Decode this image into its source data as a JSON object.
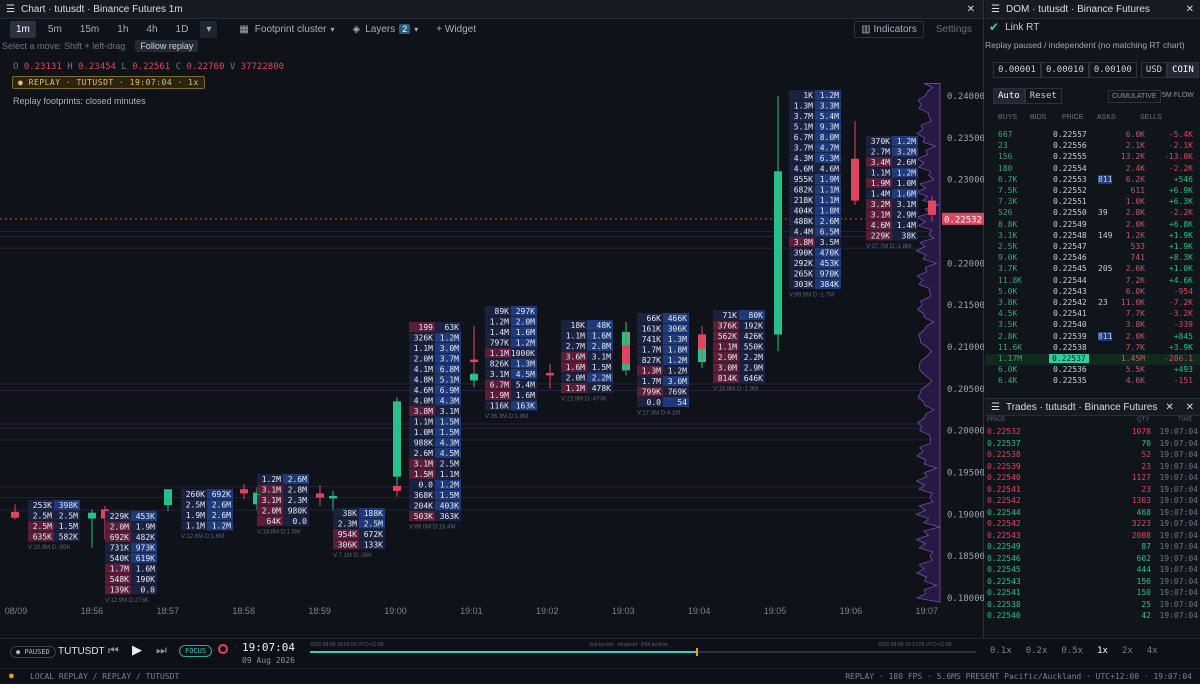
{
  "chart_panel": {
    "title": "Chart · tutusdt · Binance Futures 1m",
    "timeframes": [
      "1m",
      "5m",
      "15m",
      "1h",
      "4h",
      "1D"
    ],
    "active_timeframe": "1m",
    "footprint_label": "Footprint cluster",
    "layers_label": "Layers",
    "layers_count": "2",
    "widget_label": "+ Widget",
    "indicators_label": "Indicators",
    "settings_label": "Settings",
    "hint": "Select a move: Shift + left-drag",
    "follow_label": "Follow replay",
    "ohlc": {
      "o_label": "O",
      "o": "0.23131",
      "h_label": "H",
      "h": "0.23454",
      "l_label": "L",
      "l": "0.22561",
      "c_label": "C",
      "c": "0.22760",
      "v_label": "V",
      "v": "37722800"
    },
    "replay_badge": "● REPLAY · TUTUSDT · 19:07:04 · 1x",
    "footprint_note": "Replay footprints: closed minutes",
    "price_tag": "0.22532"
  },
  "chart_data": {
    "type": "candlestick",
    "y_ticks": [
      "0.24000",
      "0.23500",
      "0.23000",
      "0.22500",
      "0.22000",
      "0.21500",
      "0.21000",
      "0.20500",
      "0.20000",
      "0.19500",
      "0.19000",
      "0.18500",
      "0.18000"
    ],
    "y_range": [
      0.1795,
      0.2418
    ],
    "x_ticks": [
      "08/09",
      "18:56",
      "18:57",
      "18:58",
      "18:59",
      "19:00",
      "19:01",
      "19:02",
      "19:03",
      "19:04",
      "19:05",
      "19:06",
      "19:07"
    ],
    "candles": [
      {
        "o": 0.1903,
        "h": 0.1912,
        "l": 0.1894,
        "c": 0.1896,
        "bull": false
      },
      {
        "o": 0.1895,
        "h": 0.1906,
        "l": 0.186,
        "c": 0.1902,
        "bull": true
      },
      {
        "o": 0.1906,
        "h": 0.191,
        "l": 0.187,
        "c": 0.1895,
        "bull": false
      },
      {
        "o": 0.1911,
        "h": 0.1918,
        "l": 0.1904,
        "c": 0.193,
        "bull": true
      },
      {
        "o": 0.193,
        "h": 0.1936,
        "l": 0.1918,
        "c": 0.1925,
        "bull": false
      },
      {
        "o": 0.1912,
        "h": 0.1932,
        "l": 0.1905,
        "c": 0.1926,
        "bull": true
      },
      {
        "o": 0.1925,
        "h": 0.1935,
        "l": 0.191,
        "c": 0.192,
        "bull": false
      },
      {
        "o": 0.1919,
        "h": 0.1928,
        "l": 0.1904,
        "c": 0.1922,
        "bull": true
      },
      {
        "o": 0.1928,
        "h": 0.1942,
        "l": 0.1921,
        "c": 0.1934,
        "bull": false
      },
      {
        "o": 0.1945,
        "h": 0.204,
        "l": 0.1936,
        "c": 0.2035,
        "bull": true
      },
      {
        "o": 0.206,
        "h": 0.2072,
        "l": 0.2052,
        "c": 0.2068,
        "bull": true
      },
      {
        "o": 0.2085,
        "h": 0.2125,
        "l": 0.207,
        "c": 0.2082,
        "bull": false
      },
      {
        "o": 0.2069,
        "h": 0.208,
        "l": 0.205,
        "c": 0.2066,
        "bull": false
      },
      {
        "o": 0.2072,
        "h": 0.213,
        "l": 0.2066,
        "c": 0.2118,
        "bull": true
      },
      {
        "o": 0.2102,
        "h": 0.2118,
        "l": 0.207,
        "c": 0.208,
        "bull": false
      },
      {
        "o": 0.2082,
        "h": 0.2125,
        "l": 0.2075,
        "c": 0.211,
        "bull": true
      },
      {
        "o": 0.2115,
        "h": 0.2125,
        "l": 0.2085,
        "c": 0.2098,
        "bull": false
      },
      {
        "o": 0.2115,
        "h": 0.24,
        "l": 0.2095,
        "c": 0.231,
        "bull": true
      },
      {
        "o": 0.2325,
        "h": 0.237,
        "l": 0.227,
        "c": 0.2305,
        "bull": false
      },
      {
        "o": 0.2312,
        "h": 0.234,
        "l": 0.227,
        "c": 0.2275,
        "bull": false
      },
      {
        "o": 0.2275,
        "h": 0.228,
        "l": 0.225,
        "c": 0.2258,
        "bull": false
      }
    ],
    "footprints": [
      {
        "x": 28,
        "y": 500,
        "rows": [
          [
            "253K",
            "398K"
          ],
          [
            "2.5M",
            "2.5M"
          ],
          [
            "2.5M",
            "1.5M"
          ],
          [
            "635K",
            "582K"
          ]
        ],
        "foot": "V:10.9M D:-99K"
      },
      {
        "x": 105,
        "y": 511,
        "rows": [
          [
            "229K",
            "453K"
          ],
          [
            "2.0M",
            "1.9M"
          ],
          [
            "692K",
            "482K"
          ],
          [
            "731K",
            "973K"
          ],
          [
            "540K",
            "619K"
          ],
          [
            "1.7M",
            "1.6M"
          ],
          [
            "548K",
            "190K"
          ],
          [
            "139K",
            "0.0"
          ]
        ],
        "foot": "V:12.9M D:273K"
      },
      {
        "x": 181,
        "y": 489,
        "rows": [
          [
            "260K",
            "692K"
          ],
          [
            "2.5M",
            "2.6M"
          ],
          [
            "1.9M",
            "2.6M"
          ],
          [
            "1.1M",
            "1.2M"
          ]
        ],
        "foot": "V:12.6M D:1.6M"
      },
      {
        "x": 257,
        "y": 474,
        "rows": [
          [
            "1.2M",
            "2.6M"
          ],
          [
            "3.1M",
            "2.8M"
          ],
          [
            "3.1M",
            "2.3M"
          ],
          [
            "2.0M",
            "980K"
          ],
          [
            "64K",
            "0.0"
          ]
        ],
        "foot": "V:18.8M D:1.5M"
      },
      {
        "x": 333,
        "y": 508,
        "rows": [
          [
            "38K",
            "188K"
          ],
          [
            "2.3M",
            "2.5M"
          ],
          [
            "954K",
            "672K"
          ],
          [
            "306K",
            "133K"
          ]
        ],
        "foot": "V:7.1M D:-26K"
      },
      {
        "x": 409,
        "y": 322,
        "rows": [
          [
            "199",
            "63K"
          ],
          [
            "326K",
            "1.2M"
          ],
          [
            "1.1M",
            "3.0M"
          ],
          [
            "2.0M",
            "3.7M"
          ],
          [
            "4.1M",
            "6.8M"
          ],
          [
            "4.8M",
            "5.1M"
          ],
          [
            "4.6M",
            "6.9M"
          ],
          [
            "4.0M",
            "4.3M"
          ],
          [
            "3.8M",
            "3.1M"
          ],
          [
            "1.1M",
            "1.5M"
          ],
          [
            "1.0M",
            "1.5M"
          ],
          [
            "988K",
            "4.3M"
          ],
          [
            "2.6M",
            "4.5M"
          ],
          [
            "3.1M",
            "2.5M"
          ],
          [
            "1.5M",
            "1.1M"
          ],
          [
            "0.0",
            "1.2M"
          ],
          [
            "368K",
            "1.5M"
          ],
          [
            "204K",
            "403K"
          ],
          [
            "503K",
            "363K"
          ]
        ],
        "foot": "V:89.0M D:18.4M"
      },
      {
        "x": 485,
        "y": 306,
        "rows": [
          [
            "89K",
            "297K"
          ],
          [
            "1.2M",
            "2.0M"
          ],
          [
            "1.4M",
            "1.6M"
          ],
          [
            "797K",
            "1.2M"
          ],
          [
            "1.1M",
            "1000K"
          ],
          [
            "826K",
            "1.3M"
          ],
          [
            "3.1M",
            "4.5M"
          ],
          [
            "6.7M",
            "5.4M"
          ],
          [
            "1.9M",
            "1.6M"
          ],
          [
            "116K",
            "163K"
          ]
        ],
        "foot": "V:36.3M D:1.8M"
      },
      {
        "x": 561,
        "y": 320,
        "rows": [
          [
            "18K",
            "48K"
          ],
          [
            "1.1M",
            "1.6M"
          ],
          [
            "2.7M",
            "2.8M"
          ],
          [
            "3.6M",
            "3.1M"
          ],
          [
            "1.6M",
            "1.5M"
          ],
          [
            "2.0M",
            "2.2M"
          ],
          [
            "1.1M",
            "478K"
          ]
        ],
        "foot": "V:23.9M D:-470K"
      },
      {
        "x": 637,
        "y": 313,
        "rows": [
          [
            "66K",
            "466K"
          ],
          [
            "161K",
            "306K"
          ],
          [
            "741K",
            "1.3M"
          ],
          [
            "1.7M",
            "1.8M"
          ],
          [
            "827K",
            "1.2M"
          ],
          [
            "1.3M",
            "1.2M"
          ],
          [
            "1.7M",
            "3.0M"
          ],
          [
            "799K",
            "769K"
          ],
          [
            "0.0",
            "54"
          ]
        ],
        "foot": "V:17.3M D:4.1M"
      },
      {
        "x": 713,
        "y": 310,
        "rows": [
          [
            "71K",
            "80K"
          ],
          [
            "376K",
            "192K"
          ],
          [
            "562K",
            "426K"
          ],
          [
            "1.1M",
            "550K"
          ],
          [
            "2.9M",
            "2.2M"
          ],
          [
            "3.0M",
            "2.9M"
          ],
          [
            "814K",
            "646K"
          ]
        ],
        "foot": "V:15.8M D:-1.9M"
      },
      {
        "x": 789,
        "y": 90,
        "rows": [
          [
            "1K",
            "1.2M"
          ],
          [
            "1.3M",
            "3.3M"
          ],
          [
            "3.7M",
            "5.4M"
          ],
          [
            "5.1M",
            "9.3M"
          ],
          [
            "6.7M",
            "8.0M"
          ],
          [
            "3.7M",
            "4.7M"
          ],
          [
            "4.3M",
            "6.3M"
          ],
          [
            "4.6M",
            "4.6M"
          ],
          [
            "955K",
            "1.9M"
          ],
          [
            "682K",
            "1.1M"
          ],
          [
            "218K",
            "1.1M"
          ],
          [
            "404K",
            "1.8M"
          ],
          [
            "488K",
            "2.6M"
          ],
          [
            "4.4M",
            "6.5M"
          ],
          [
            "3.8M",
            "3.5M"
          ],
          [
            "390K",
            "470K"
          ],
          [
            "292K",
            "453K"
          ],
          [
            "265K",
            "970K"
          ],
          [
            "303K",
            "384K"
          ]
        ],
        "foot": "V:89.5M D:-1.7M"
      },
      {
        "x": 866,
        "y": 136,
        "rows": [
          [
            "370K",
            "1.2M"
          ],
          [
            "2.7M",
            "3.2M"
          ],
          [
            "3.4M",
            "2.6M"
          ],
          [
            "1.1M",
            "1.2M"
          ],
          [
            "1.9M",
            "1.0M"
          ],
          [
            "1.4M",
            "1.6M"
          ],
          [
            "3.2M",
            "3.1M"
          ],
          [
            "3.1M",
            "2.9M"
          ],
          [
            "4.6M",
            "1.4M"
          ],
          [
            "229K",
            "38K"
          ]
        ],
        "foot": "V:37.7M D:-1.8M"
      }
    ]
  },
  "dom": {
    "title": "DOM · tutusdt · Binance Futures",
    "link_label": "Link RT",
    "status": "Replay paused / independent (no matching RT chart)",
    "ticks": [
      "0.00001",
      "0.00010",
      "0.00100"
    ],
    "units": [
      "USD",
      "COIN"
    ],
    "auto_label": "Auto",
    "reset_label": "Reset",
    "cumulative_label": "CUMULATIVE",
    "flow_label": "5M FLOW",
    "headers": [
      "BUYS",
      "BIDS",
      "PRICE",
      "ASKS",
      "SELLS"
    ],
    "rows": [
      {
        "buys": "667",
        "bids": "",
        "price": "0.22557",
        "asks": "",
        "sells": "6.0K",
        "delta": "-5.4K"
      },
      {
        "buys": "23",
        "bids": "",
        "price": "0.22556",
        "asks": "",
        "sells": "2.1K",
        "delta": "-2.1K"
      },
      {
        "buys": "156",
        "bids": "",
        "price": "0.22555",
        "asks": "",
        "sells": "13.2K",
        "delta": "-13.0K"
      },
      {
        "buys": "180",
        "bids": "",
        "price": "0.22554",
        "asks": "",
        "sells": "2.4K",
        "delta": "-2.2K"
      },
      {
        "buys": "6.7K",
        "bids": "",
        "price": "0.22553",
        "asks": "811",
        "sells": "6.2K",
        "delta": "+546"
      },
      {
        "buys": "7.5K",
        "bids": "",
        "price": "0.22552",
        "asks": "",
        "sells": "611",
        "delta": "+6.9K"
      },
      {
        "buys": "7.3K",
        "bids": "",
        "price": "0.22551",
        "asks": "",
        "sells": "1.0K",
        "delta": "+6.3K"
      },
      {
        "buys": "526",
        "bids": "",
        "price": "0.22550",
        "asks": "39",
        "sells": "2.8K",
        "delta": "-2.2K"
      },
      {
        "buys": "8.8K",
        "bids": "",
        "price": "0.22549",
        "asks": "",
        "sells": "2.0K",
        "delta": "+6.8K"
      },
      {
        "buys": "3.1K",
        "bids": "",
        "price": "0.22548",
        "asks": "149",
        "sells": "1.2K",
        "delta": "+1.9K"
      },
      {
        "buys": "2.5K",
        "bids": "",
        "price": "0.22547",
        "asks": "",
        "sells": "533",
        "delta": "+1.9K"
      },
      {
        "buys": "9.0K",
        "bids": "",
        "price": "0.22546",
        "asks": "",
        "sells": "741",
        "delta": "+8.3K"
      },
      {
        "buys": "3.7K",
        "bids": "",
        "price": "0.22545",
        "asks": "205",
        "sells": "2.6K",
        "delta": "+1.0K"
      },
      {
        "buys": "11.8K",
        "bids": "",
        "price": "0.22544",
        "asks": "",
        "sells": "7.2K",
        "delta": "+4.6K"
      },
      {
        "buys": "5.0K",
        "bids": "",
        "price": "0.22543",
        "asks": "",
        "sells": "6.0K",
        "delta": "-954"
      },
      {
        "buys": "3.8K",
        "bids": "",
        "price": "0.22542",
        "asks": "23",
        "sells": "11.0K",
        "delta": "-7.2K"
      },
      {
        "buys": "4.5K",
        "bids": "",
        "price": "0.22541",
        "asks": "",
        "sells": "7.7K",
        "delta": "-3.2K"
      },
      {
        "buys": "3.5K",
        "bids": "",
        "price": "0.22540",
        "asks": "",
        "sells": "3.8K",
        "delta": "-339"
      },
      {
        "buys": "2.8K",
        "bids": "",
        "price": "0.22539",
        "asks": "811",
        "sells": "2.0K",
        "delta": "+845"
      },
      {
        "buys": "11.6K",
        "bids": "",
        "price": "0.22538",
        "asks": "",
        "sells": "7.7K",
        "delta": "+3.9K"
      },
      {
        "buys": "1.17M",
        "bids": "",
        "price": "0.22537",
        "asks": "",
        "sells": "1.45M",
        "delta": "-286.1"
      },
      {
        "buys": "6.0K",
        "bids": "",
        "price": "0.22536",
        "asks": "",
        "sells": "5.5K",
        "delta": "+493"
      },
      {
        "buys": "6.4K",
        "bids": "",
        "price": "0.22535",
        "asks": "",
        "sells": "4.6K",
        "delta": "-151"
      }
    ]
  },
  "trades": {
    "title": "Trades · tutusdt · Binance Futures",
    "headers": [
      "PRICE",
      "QTY",
      "TIME"
    ],
    "rows": [
      {
        "price": "0.22532",
        "qty": "1078",
        "time": "19:07:04",
        "side": "sell"
      },
      {
        "price": "0.22537",
        "qty": "70",
        "time": "19:07:04",
        "side": "buy"
      },
      {
        "price": "0.22538",
        "qty": "52",
        "time": "19:07:04",
        "side": "sell"
      },
      {
        "price": "0.22539",
        "qty": "23",
        "time": "19:07:04",
        "side": "sell"
      },
      {
        "price": "0.22540",
        "qty": "1127",
        "time": "19:07:04",
        "side": "sell"
      },
      {
        "price": "0.22541",
        "qty": "23",
        "time": "19:07:04",
        "side": "sell"
      },
      {
        "price": "0.22542",
        "qty": "1303",
        "time": "19:07:04",
        "side": "sell"
      },
      {
        "price": "0.22544",
        "qty": "468",
        "time": "19:07:04",
        "side": "buy"
      },
      {
        "price": "0.22542",
        "qty": "3223",
        "time": "19:07:04",
        "side": "sell"
      },
      {
        "price": "0.22543",
        "qty": "2088",
        "time": "19:07:04",
        "side": "sell"
      },
      {
        "price": "0.22549",
        "qty": "87",
        "time": "19:07:04",
        "side": "buy"
      },
      {
        "price": "0.22546",
        "qty": "602",
        "time": "19:07:04",
        "side": "buy"
      },
      {
        "price": "0.22545",
        "qty": "444",
        "time": "19:07:04",
        "side": "buy"
      },
      {
        "price": "0.22543",
        "qty": "156",
        "time": "19:07:04",
        "side": "buy"
      },
      {
        "price": "0.22541",
        "qty": "150",
        "time": "19:07:04",
        "side": "buy"
      },
      {
        "price": "0.22538",
        "qty": "25",
        "time": "19:07:04",
        "side": "buy"
      },
      {
        "price": "0.22546",
        "qty": "42",
        "time": "19:07:04",
        "side": "buy"
      }
    ]
  },
  "bottom": {
    "paused_label": "PAUSED",
    "symbol": "TUTUSDT",
    "focus_label": "FOCUS",
    "time": "19:07:04",
    "date": "09 Aug 2026",
    "range_start": "2026-08-09 18:00:00 UTC+12:00",
    "source": "tick-by-tick · binancef · P04 archive",
    "range_end": "2026-08-09 19:17:05 UTC+12:00",
    "progress": 0.58,
    "speeds": [
      "0.1x",
      "0.2x",
      "0.5x",
      "1x",
      "2x",
      "4x"
    ],
    "active_speed": "1x",
    "status_left": "LOCAL REPLAY / REPLAY / TUTUSDT",
    "status_right": "REPLAY · 180 FPS · 5.6MS PRESENT  Pacific/Auckland · UTC+12:00 · 19:07:04"
  },
  "colors": {
    "bull": "#27c08a",
    "bear": "#e0455f",
    "accent": "#2fd0c8",
    "bg": "#0f1218"
  }
}
